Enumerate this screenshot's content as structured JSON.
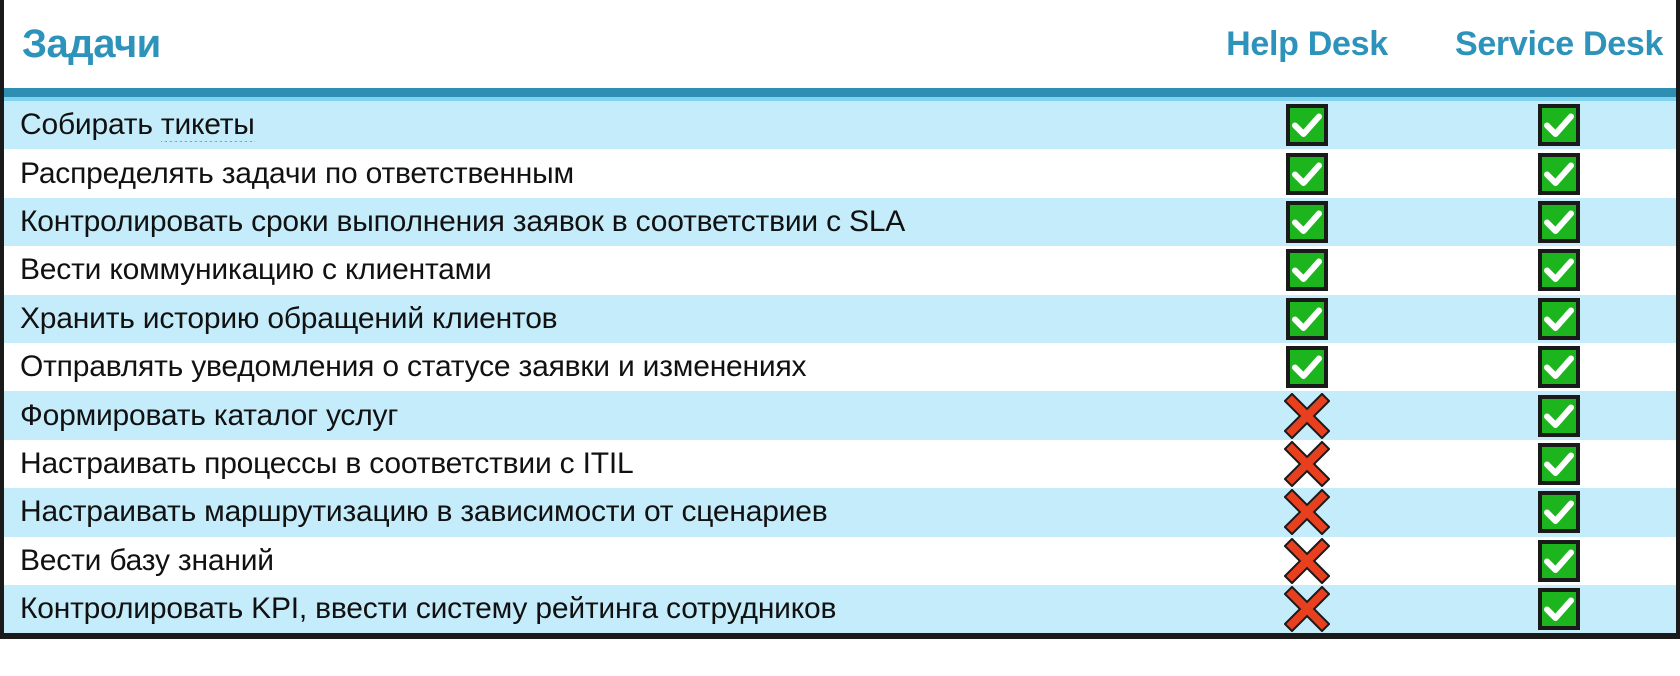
{
  "header": {
    "task_column_label": "Задачи",
    "columns": [
      {
        "label": "Help Desk",
        "key": "help_desk"
      },
      {
        "label": "Service Desk",
        "key": "service_desk"
      }
    ]
  },
  "colors": {
    "heading_teal": "#2e93ba",
    "rule_teal": "#2e8fb3",
    "rule_light_blue": "#7fd3ef",
    "row_alt_blue": "#c5ecfa",
    "row_base_white": "#ffffff",
    "check_green": "#1db51d",
    "check_glyph_white": "#ffffff",
    "cross_red": "#e8401f",
    "outline_black": "#1a1a1a",
    "spellcheck_red": "#e8453c",
    "body_text": "#111111"
  },
  "icons": {
    "check": {
      "name": "green-check-icon",
      "glyph": "✔"
    },
    "cross": {
      "name": "red-cross-icon",
      "glyph": "✖"
    }
  },
  "rows": [
    {
      "task": "Собирать тикеты",
      "misspelled_word": "тикеты",
      "task_prefix": "Собирать ",
      "help_desk": "check",
      "service_desk": "check"
    },
    {
      "task": "Распределять задачи по ответственным",
      "misspelled_word": "",
      "task_prefix": "",
      "help_desk": "check",
      "service_desk": "check"
    },
    {
      "task": "Контролировать сроки выполнения заявок в соответствии с SLA",
      "misspelled_word": "",
      "task_prefix": "",
      "help_desk": "check",
      "service_desk": "check"
    },
    {
      "task": "Вести коммуникацию с клиентами",
      "misspelled_word": "",
      "task_prefix": "",
      "help_desk": "check",
      "service_desk": "check"
    },
    {
      "task": "Хранить историю обращений клиентов",
      "misspelled_word": "",
      "task_prefix": "",
      "help_desk": "check",
      "service_desk": "check"
    },
    {
      "task": "Отправлять уведомления о статусе заявки и изменениях",
      "misspelled_word": "",
      "task_prefix": "",
      "help_desk": "check",
      "service_desk": "check"
    },
    {
      "task": "Формировать каталог услуг",
      "misspelled_word": "",
      "task_prefix": "",
      "help_desk": "cross",
      "service_desk": "check"
    },
    {
      "task": "Настраивать процессы в соответствии с ITIL",
      "misspelled_word": "",
      "task_prefix": "",
      "help_desk": "cross",
      "service_desk": "check"
    },
    {
      "task": "Настраивать маршрутизацию в зависимости от сценариев",
      "misspelled_word": "",
      "task_prefix": "",
      "help_desk": "cross",
      "service_desk": "check"
    },
    {
      "task": "Вести базу знаний",
      "misspelled_word": "",
      "task_prefix": "",
      "help_desk": "cross",
      "service_desk": "check"
    },
    {
      "task": "Контролировать KPI, ввести систему рейтинга сотрудников",
      "misspelled_word": "",
      "task_prefix": "",
      "help_desk": "cross",
      "service_desk": "check"
    }
  ]
}
